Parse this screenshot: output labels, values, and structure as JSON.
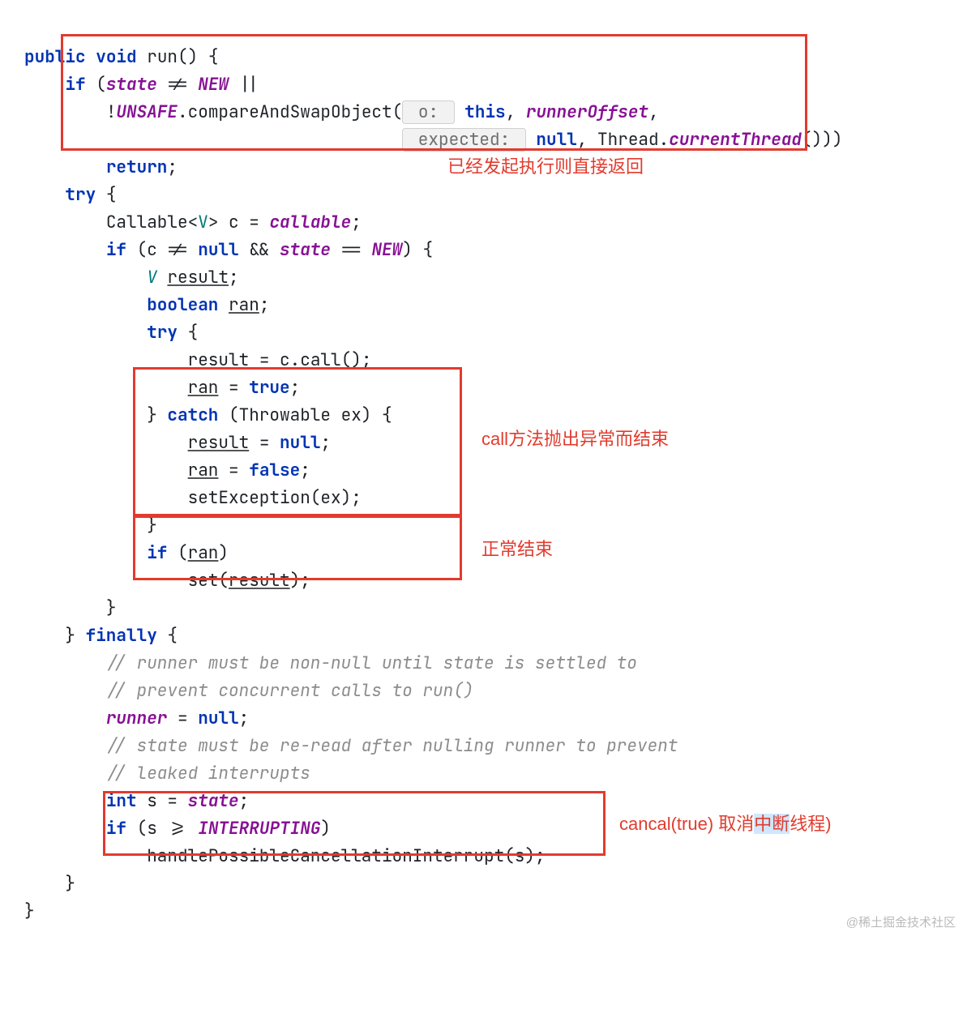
{
  "code": {
    "l1": {
      "kw1": "public",
      "kw2": "void",
      "name": "run",
      "tail": "() {"
    },
    "l2": {
      "kw": "if",
      "open": " (",
      "var": "state",
      "op": " != ",
      "c": "NEW",
      "tail": " ||"
    },
    "l3": {
      "bang": "!",
      "u": "UNSAFE",
      "m": ".compareAndSwapObject(",
      "hint": " o: ",
      "kw": "this",
      "comma": ", ",
      "f": "runnerOffset",
      "tail": ","
    },
    "l4": {
      "hint": " expected: ",
      "kwn": "null",
      "mid": ", Thread.",
      "sm": "currentThread",
      "tail": "()))"
    },
    "l5": {
      "kw": "return",
      "semi": ";"
    },
    "l6": {
      "kw": "try",
      "brace": " {"
    },
    "l7": {
      "pre": "Callable<",
      "gen": "V",
      "post": "> c = ",
      "f": "callable",
      "semi": ";"
    },
    "l8": {
      "kw": "if",
      "pre": " (c != ",
      "kwn": "null",
      "and": " && ",
      "var": "state",
      "eq": " == ",
      "c": "NEW",
      "tail": ") {"
    },
    "l9": {
      "g": "V",
      "sp": " ",
      "u": "result",
      "semi": ";"
    },
    "l10": {
      "kw": "boolean",
      "sp": " ",
      "u": "ran",
      "semi": ";"
    },
    "l11": {
      "kw": "try",
      "brace": " {"
    },
    "l12": {
      "u": "result",
      "rest": " = c.call();"
    },
    "l13": {
      "u": "ran",
      "eq": " = ",
      "kw": "true",
      "semi": ";"
    },
    "l14": {
      "close": "} ",
      "kw": "catch",
      "rest": " (Throwable ex) {"
    },
    "l15": {
      "u": "result",
      "eq": " = ",
      "kwn": "null",
      "semi": ";"
    },
    "l16": {
      "u": "ran",
      "eq": " = ",
      "kw": "false",
      "semi": ";"
    },
    "l17": {
      "m": "setException(ex);"
    },
    "l18": {
      "close": "}"
    },
    "l19": {
      "kw": "if",
      "open": " (",
      "u": "ran",
      "close": ")"
    },
    "l20": {
      "m": "set(",
      "u": "result",
      "close": ");"
    },
    "l21": {
      "close": "}"
    },
    "l22": {
      "close": "} ",
      "kw": "finally",
      "brace": " {"
    },
    "l23": {
      "c": "// runner must be non-null until state is settled to"
    },
    "l24": {
      "c": "// prevent concurrent calls to run()"
    },
    "l25": {
      "f": "runner",
      "eq": " = ",
      "kwn": "null",
      "semi": ";"
    },
    "l26": {
      "c": "// state must be re-read after nulling runner to prevent"
    },
    "l27": {
      "c": "// leaked interrupts"
    },
    "l28": {
      "kw": "int",
      "rest": " s = ",
      "f": "state",
      "semi": ";"
    },
    "l29": {
      "kw": "if",
      "pre": " (s >= ",
      "c": "INTERRUPTING",
      "close": ")"
    },
    "l30": {
      "m": "handlePossibleCancellationInterrupt(s);"
    },
    "l31": {
      "close": "}"
    },
    "l32": {
      "close": "}"
    }
  },
  "annotations": {
    "a1": "已经发起执行则直接返回",
    "a2": "call方法抛出异常而结束",
    "a3": "正常结束",
    "a4_pre": "cancal(true) 取消",
    "a4_hl": "中断",
    "a4_post": "线程)"
  },
  "watermark": "@稀土掘金技术社区"
}
